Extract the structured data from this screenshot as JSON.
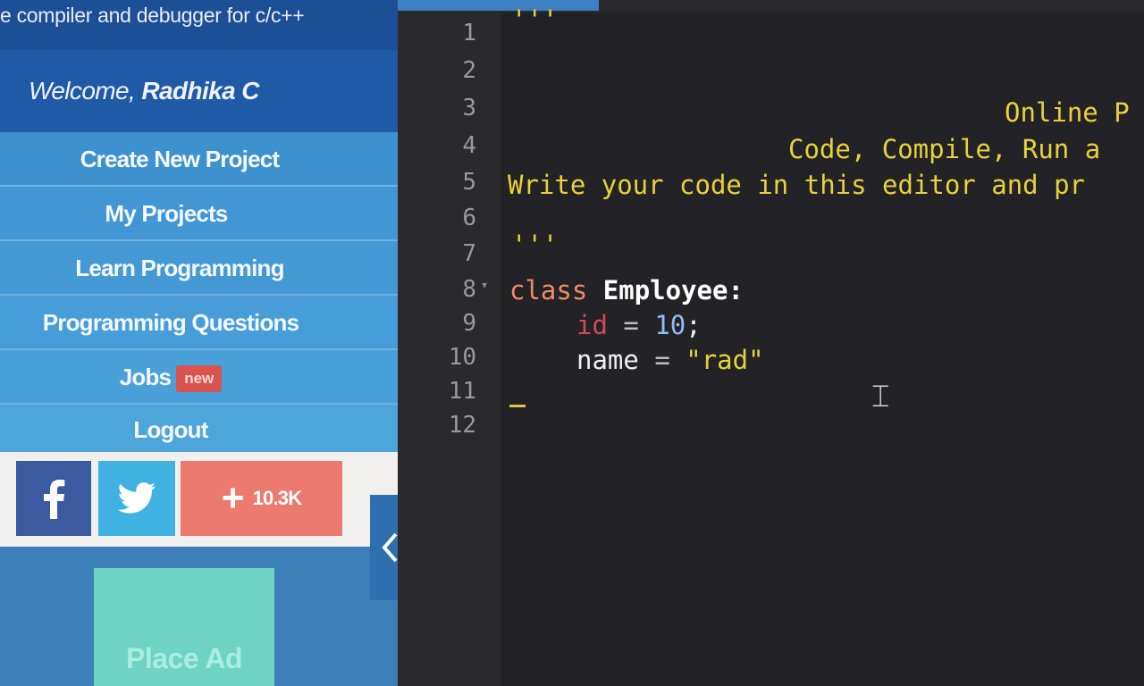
{
  "sidebar": {
    "tagline": "e compiler and debugger for c/c++",
    "welcome_prefix": "Welcome, ",
    "user_name": "Radhika C",
    "menu": [
      {
        "label": "Create New Project"
      },
      {
        "label": "My Projects"
      },
      {
        "label": "Learn Programming"
      },
      {
        "label": "Programming Questions"
      },
      {
        "label": "Jobs",
        "badge": "new"
      },
      {
        "label": "Logout"
      }
    ],
    "social": {
      "facebook_icon": "facebook-icon",
      "twitter_icon": "twitter-icon",
      "plus_count": "10.3K"
    },
    "collapse_icon": "chevron-left-icon",
    "ad_label": "Place Ad"
  },
  "editor": {
    "line_numbers": [
      "1",
      "2",
      "3",
      "4",
      "5",
      "6",
      "7",
      "8",
      "9",
      "10",
      "11",
      "12"
    ],
    "lines": {
      "l1": "'''",
      "l3": "Online P",
      "l4": "Code, Compile, Run a",
      "l5": "Write your code in this editor and pr",
      "l7": "'''",
      "l8_kw": "class",
      "l8_name": "Employee:",
      "l9_var": "id",
      "l9_op": "=",
      "l9_num": "10",
      "l9_end": ";",
      "l10_var": "name",
      "l10_op": "=",
      "l10_str": "\"rad\""
    }
  },
  "colors": {
    "sidebar_header": "#1c4f95",
    "menu_blue": "#3e91cf",
    "editor_bg": "#232226",
    "string_yellow": "#e6d23a",
    "keyword": "#f08a6a"
  }
}
